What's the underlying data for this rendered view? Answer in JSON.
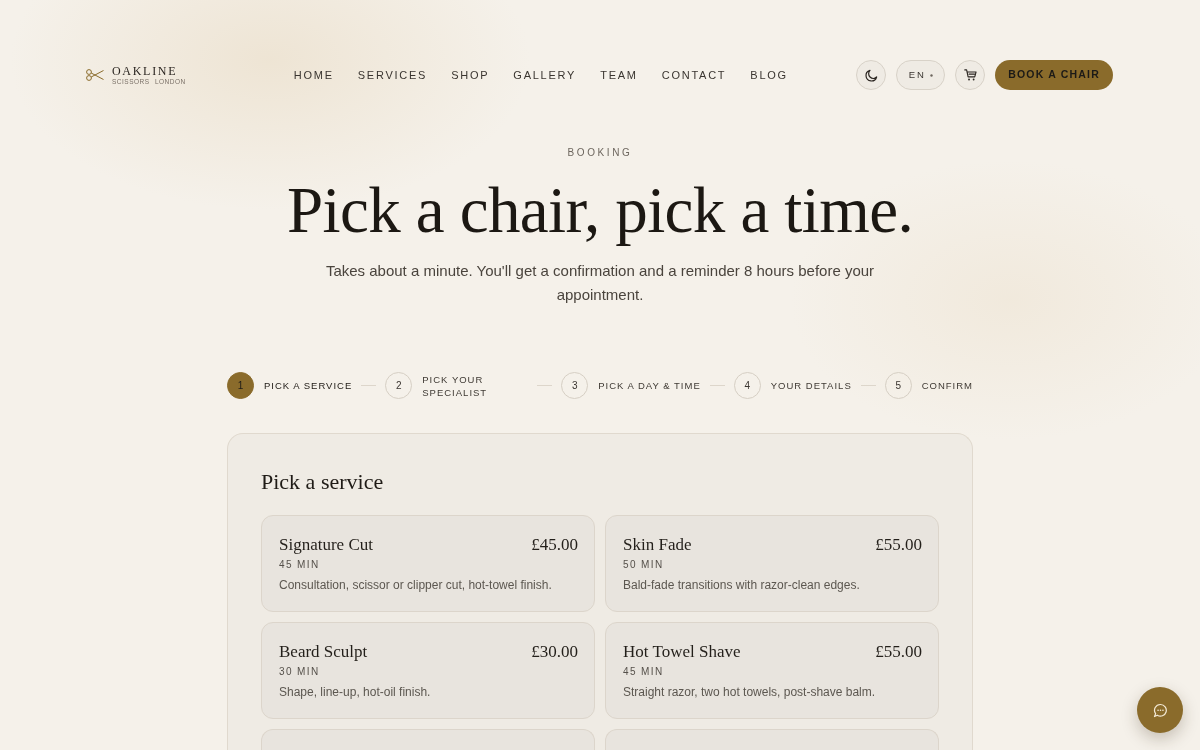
{
  "brand": {
    "name": "OAKLINE",
    "tagline": "SCISSORS LONDON"
  },
  "nav": {
    "links": [
      {
        "label": "HOME"
      },
      {
        "label": "SERVICES"
      },
      {
        "label": "SHOP"
      },
      {
        "label": "GALLERY"
      },
      {
        "label": "TEAM"
      },
      {
        "label": "CONTACT"
      },
      {
        "label": "BLOG"
      }
    ]
  },
  "header_actions": {
    "language": "EN",
    "cta": "BOOK A CHAIR"
  },
  "hero": {
    "eyebrow": "BOOKING",
    "title": "Pick a chair, pick a time.",
    "subtitle": "Takes about a minute. You'll get a confirmation and a reminder 8 hours before your appointment."
  },
  "steps": [
    {
      "number": "1",
      "label": "PICK A SERVICE",
      "selected": true
    },
    {
      "number": "2",
      "label": "PICK YOUR SPECIALIST",
      "selected": false
    },
    {
      "number": "3",
      "label": "PICK A DAY & TIME",
      "selected": false
    },
    {
      "number": "4",
      "label": "YOUR DETAILS",
      "selected": false
    },
    {
      "number": "5",
      "label": "CONFIRM",
      "selected": false
    }
  ],
  "panel": {
    "title": "Pick a service",
    "services": [
      {
        "name": "Signature Cut",
        "price": "£45.00",
        "duration": "45 MIN",
        "description": "Consultation, scissor or clipper cut, hot-towel finish."
      },
      {
        "name": "Skin Fade",
        "price": "£55.00",
        "duration": "50 MIN",
        "description": "Bald-fade transitions with razor-clean edges."
      },
      {
        "name": "Beard Sculpt",
        "price": "£30.00",
        "duration": "30 MIN",
        "description": "Shape, line-up, hot-oil finish."
      },
      {
        "name": "Hot Towel Shave",
        "price": "£55.00",
        "duration": "45 MIN",
        "description": "Straight razor, two hot towels, post-shave balm."
      }
    ]
  }
}
